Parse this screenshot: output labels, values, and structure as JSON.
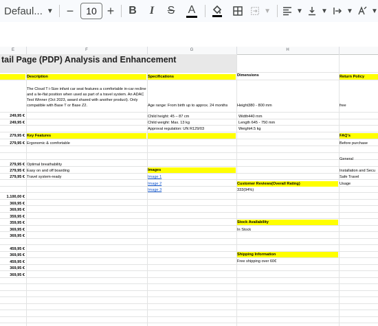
{
  "toolbar": {
    "font_name": "Defaul...",
    "font_size": "10",
    "decrease_label": "−",
    "increase_label": "+",
    "bold": "B",
    "italic": "I",
    "strike": "S",
    "text_color": "A"
  },
  "columns": [
    "E",
    "F",
    "G",
    "H",
    ""
  ],
  "sheet": {
    "title": "tail Page (PDP) Analysis and Enhancement",
    "headers": {
      "description": "Description",
      "specifications": "Specifications",
      "dimensions": "Dimensions",
      "return_policy": "Return Policy"
    },
    "description_text": "The Cloud T i-Size infant car seat features a comfortable in-car recline and a lie-flat position when used as part of a travel system. An ADAC Test Winner (Oct 2023, award shared with another product). Only compatible with Base T or Base Z2.",
    "specs": [
      "Age range: From birth up to approx. 24 months",
      "Child height: 45 – 87 cm",
      "Child weight: Max. 13 kg",
      "Approval regulation: UN R129/03"
    ],
    "dims": [
      "Height380 - 800 mm",
      "Width440 mm",
      "Length 645 - 750 mm",
      "Weight4.5 kg"
    ],
    "return_free": "free",
    "key_features_label": "Key Features",
    "features": [
      "Ergonomic & comfortable",
      "Optimal breathability",
      "Easy on and off boarding",
      "Travel system-ready"
    ],
    "faqs_label": "FAQ's",
    "faqs": [
      "Before purchase",
      "General",
      "Installation and Secu",
      "Safe Travel",
      "Usage"
    ],
    "images_label": "Images",
    "images": [
      "Image 1",
      "Image 2",
      "Image 3"
    ],
    "reviews_label": "Customer Reviews(Overall Rating)",
    "reviews_value": "333(94%)",
    "stock_label": "Stock Availability",
    "stock_value": "In Stock",
    "shipping_label": "Shipping Information",
    "shipping_value": "Free shipping over 60€",
    "prices": [
      "249,95 €",
      "249,95 €",
      "279,95 €",
      "279,95 €",
      "279,95 €",
      "279,95 €",
      "279,95 €",
      "1.100,00 €",
      "369,95 €",
      "369,95 €",
      "359,95 €",
      "359,95 €",
      "369,95 €",
      "369,95 €",
      "459,95 €",
      "369,95 €",
      "459,95 €",
      "369,95 €",
      "369,95 €"
    ]
  }
}
